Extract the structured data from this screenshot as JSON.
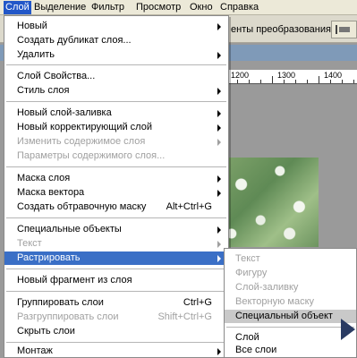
{
  "menubar": {
    "items": [
      "Слой",
      "Выделение",
      "Фильтр",
      "Просмотр",
      "Окно",
      "Справка"
    ]
  },
  "optbar": {
    "transform_label": "енты преобразования"
  },
  "ruler": {
    "labels": [
      "1200",
      "1300",
      "1400"
    ]
  },
  "menu": {
    "new": "Новый",
    "duplicate": "Создать дубликат слоя...",
    "delete": "Удалить",
    "layer_props": "Слой Свойства...",
    "layer_style": "Стиль слоя",
    "new_fill": "Новый слой-заливка",
    "new_adjust": "Новый корректирующий слой",
    "change_content": "Изменить содержимое слоя",
    "content_options": "Параметры содержимого слоя...",
    "layer_mask": "Маска слоя",
    "vector_mask": "Маска вектора",
    "clipping_mask": "Создать обтравочную маску",
    "clipping_mask_sc": "Alt+Ctrl+G",
    "smart_objects": "Специальные объекты",
    "type": "Текст",
    "rasterize": "Растрировать",
    "new_slice": "Новый фрагмент из слоя",
    "group": "Группировать слои",
    "group_sc": "Ctrl+G",
    "ungroup": "Разгруппировать слои",
    "ungroup_sc": "Shift+Ctrl+G",
    "hide": "Скрыть слои",
    "arrange": "Монтаж"
  },
  "submenu": {
    "type": "Текст",
    "shape": "Фигуру",
    "fill": "Слой-заливку",
    "vector_mask": "Векторную маску",
    "smart_object": "Специальный объект",
    "layer": "Слой",
    "all_layers": "Все слои"
  },
  "colors": {
    "highlight": "#3a6fc6",
    "menubar_active": "#2257c8"
  }
}
